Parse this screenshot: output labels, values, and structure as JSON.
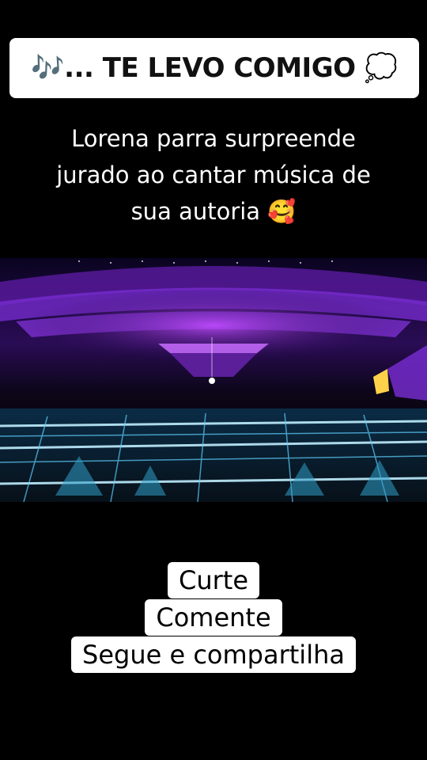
{
  "banner": {
    "text": "🎶... TE LEVO COMIGO 💭"
  },
  "caption": {
    "line1": "Lorena parra surpreende",
    "line2": "jurado ao cantar música de",
    "line3": "sua autoria 🥰"
  },
  "video": {
    "scene": "stage-performance"
  },
  "cta": {
    "line1": "Curte",
    "line2": "Comente",
    "line3": "Segue e compartilha"
  },
  "colors": {
    "background": "#000000",
    "banner": "#ffffff",
    "stage_accent": "#9b2cff",
    "floor_accent": "#47c6ff"
  }
}
